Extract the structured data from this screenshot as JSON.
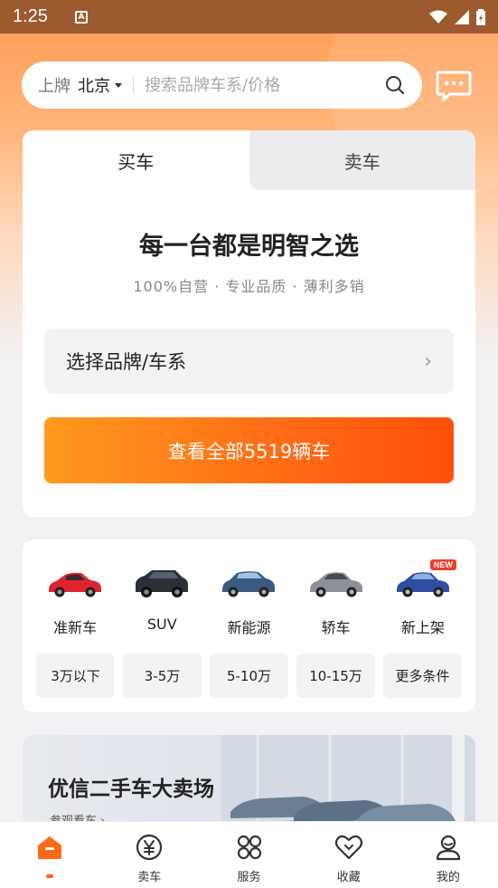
{
  "status_bar": {
    "time": "1:25",
    "notification_glyph": "A"
  },
  "search": {
    "plate_label": "上牌",
    "city": "北京",
    "placeholder": "搜索品牌车系/价格"
  },
  "buy_card": {
    "tabs": [
      {
        "label": "买车",
        "active": true
      },
      {
        "label": "卖车",
        "active": false
      }
    ],
    "slogan": "每一台都是明智之选",
    "sub_slogan": "100%自营 · 专业品质 · 薄利多销",
    "brand_select_label": "选择品牌/车系",
    "view_all_label": "查看全部5519辆车"
  },
  "categories": [
    {
      "label": "准新车",
      "car_color": "#e0242e"
    },
    {
      "label": "SUV",
      "car_color": "#2b2f38"
    },
    {
      "label": "新能源",
      "car_color": "#3a5a80"
    },
    {
      "label": "轿车",
      "car_color": "#8d9097"
    },
    {
      "label": "新上架",
      "car_color": "#2c4fa3",
      "badge": "NEW"
    }
  ],
  "price_filters": [
    "3万以下",
    "3-5万",
    "5-10万",
    "10-15万",
    "更多条件"
  ],
  "banner": {
    "title": "优信二手车大卖场",
    "subtitle": "参观看车 ›"
  },
  "bottom_nav": [
    {
      "label": "",
      "icon": "home-icon",
      "active": true
    },
    {
      "label": "卖车",
      "icon": "yen-icon",
      "active": false
    },
    {
      "label": "服务",
      "icon": "services-icon",
      "active": false
    },
    {
      "label": "收藏",
      "icon": "heart-icon",
      "active": false
    },
    {
      "label": "我的",
      "icon": "user-icon",
      "active": false
    }
  ],
  "colors": {
    "accent": "#ff6a14",
    "gradient_start": "#ff9a1f",
    "gradient_end": "#ff4f0a",
    "badge_red": "#f03d2f"
  }
}
